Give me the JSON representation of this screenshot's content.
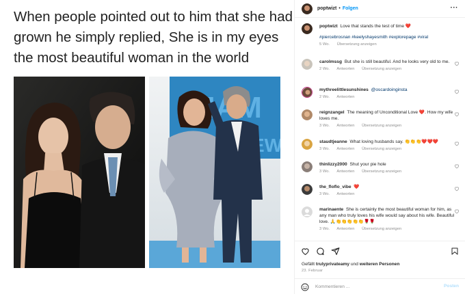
{
  "post": {
    "meme_lines": [
      "When people pointed out to him that she had",
      "grown he simply replied, She is in my eyes",
      "the most beautiful woman in the world"
    ]
  },
  "header": {
    "username": "poptwizt",
    "separator": "•",
    "follow_label": "Folgen",
    "more_label": "···"
  },
  "caption": {
    "username": "poptwizt",
    "text": "Love that stands the test of time",
    "emoji": "❤️",
    "hashtags": "#piercebrosnan #keelyshayesmith #explorepage #viral",
    "time": "5 Wo.",
    "translate": "Übersetzung anzeigen"
  },
  "comments": [
    {
      "username": "carolmssg",
      "text": "But she is still beautiful. And he looks very old to me.",
      "time": "2 Wo.",
      "reply": "Antworten",
      "translate": "Übersetzung anzeigen"
    },
    {
      "username": "mythreelittlesunshines",
      "text": "@oscardoinginsta",
      "time": "2 Wo.",
      "reply": "Antworten",
      "translate": ""
    },
    {
      "username": "reignzangel",
      "text": "The meaning of Unconditional Love ❤️. How my wife loves me.",
      "time": "3 Wo.",
      "reply": "Antworten",
      "translate": "Übersetzung anzeigen"
    },
    {
      "username": "staudtjeanne",
      "text": "What loving husbands say. 👏👏👏❤️❤️❤️",
      "time": "3 Wo.",
      "reply": "Antworten",
      "translate": "Übersetzung anzeigen"
    },
    {
      "username": "thinlizzy2000",
      "text": "Shut your pie hole",
      "time": "3 Wo.",
      "reply": "Antworten",
      "translate": "Übersetzung anzeigen"
    },
    {
      "username": "the_floflo_vibe",
      "text": "❤️",
      "time": "3 Wo.",
      "reply": "Antworten",
      "translate": ""
    },
    {
      "username": "marinaente",
      "text": "She is certainly the most beautiful woman for him, as any man who truly loves his wife would say about his wife. Beautiful love. 🙏👏👏👏👏👏🌹🌹",
      "time": "3 Wo.",
      "reply": "Antworten",
      "translate": "Übersetzung anzeigen"
    }
  ],
  "footer": {
    "likes_prefix": "Gefällt",
    "likes_user": "trulyprivateamy",
    "likes_middle": "und",
    "likes_suffix": "weiteren Personen",
    "date": "23. Februar",
    "comment_placeholder": "Kommentieren ...",
    "post_label": "Posten"
  },
  "colors": {
    "accent": "#0095f6",
    "hashtag": "#00376b",
    "muted": "#8e8e8e",
    "heart": "#ed4956"
  }
}
